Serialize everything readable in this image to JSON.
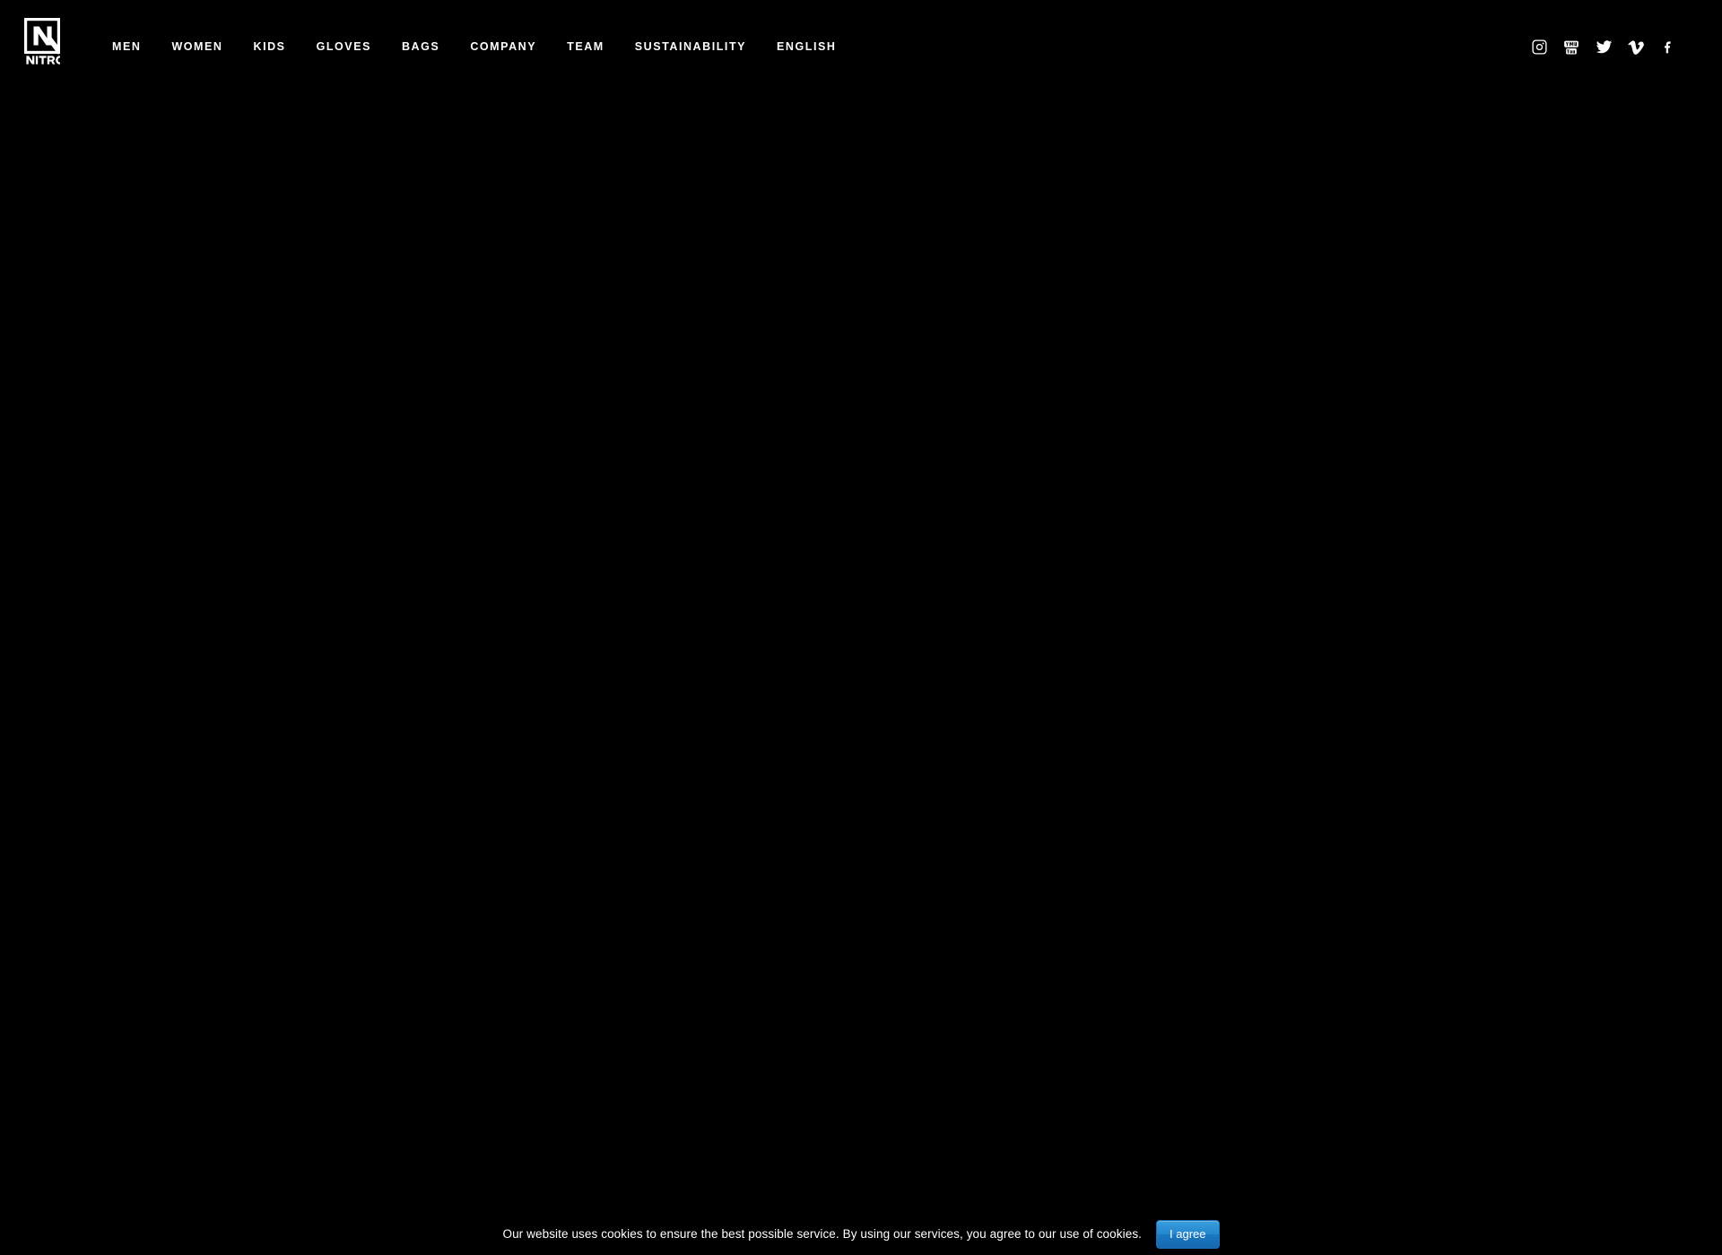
{
  "page": {
    "background_color": "#000000",
    "text_color": "#ffffff"
  },
  "header": {
    "logo": {
      "name": "nitro-logo",
      "wordmark": "NITRO",
      "letter": "N"
    },
    "nav_items": [
      {
        "label": "MEN",
        "name": "nav-item-men"
      },
      {
        "label": "WOMEN",
        "name": "nav-item-women"
      },
      {
        "label": "KIDS",
        "name": "nav-item-kids"
      },
      {
        "label": "GLOVES",
        "name": "nav-item-gloves"
      },
      {
        "label": "BAGS",
        "name": "nav-item-bags"
      },
      {
        "label": "COMPANY",
        "name": "nav-item-company"
      },
      {
        "label": "TEAM",
        "name": "nav-item-team"
      },
      {
        "label": "SUSTAINABILITY",
        "name": "nav-item-sustainability"
      },
      {
        "label": "ENGLISH",
        "name": "nav-item-english"
      }
    ],
    "social_links": [
      {
        "icon": "instagram-icon",
        "label": "Instagram"
      },
      {
        "icon": "youtube-icon",
        "label": "YouTube"
      },
      {
        "icon": "twitter-icon",
        "label": "Twitter"
      },
      {
        "icon": "vimeo-icon",
        "label": "Vimeo"
      },
      {
        "icon": "facebook-icon",
        "label": "Facebook"
      }
    ]
  },
  "cookie_banner": {
    "message": "Our website uses cookies to ensure the best possible service. By using our services, you agree to our use of cookies.",
    "accept_label": "I agree",
    "accept_color": "#2486cd"
  }
}
